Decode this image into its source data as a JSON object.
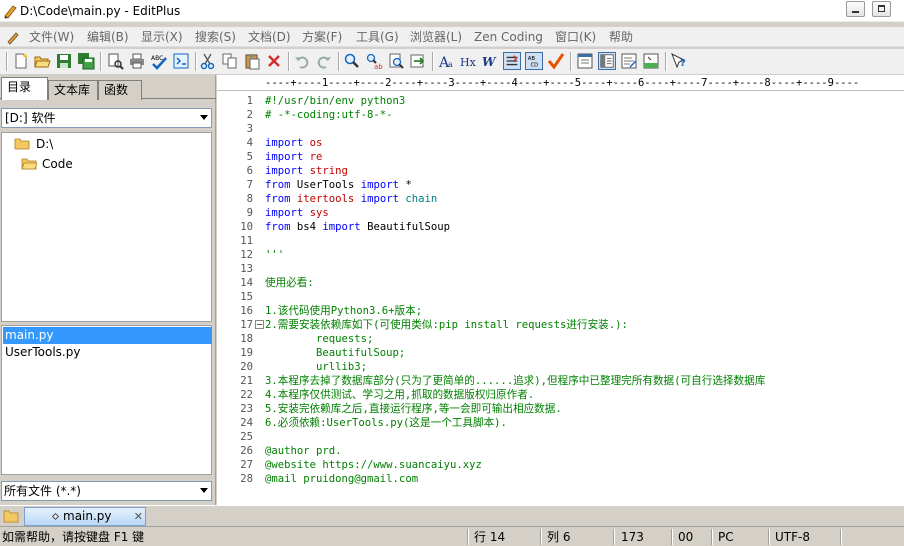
{
  "window": {
    "title": "D:\\Code\\main.py - EditPlus"
  },
  "menu": {
    "items": [
      "文件(W)",
      "编辑(B)",
      "显示(X)",
      "搜索(S)",
      "文档(D)",
      "方案(F)",
      "工具(G)",
      "浏览器(L)",
      "Zen Coding",
      "窗口(K)",
      "帮助"
    ]
  },
  "toolbar": {
    "icons": [
      "new-file-icon",
      "open-icon",
      "save-icon",
      "save-all-icon",
      "print-preview-icon",
      "print-icon",
      "spell-check-icon",
      "check-icon",
      "browser-view-icon",
      "cut-icon",
      "copy-icon",
      "paste-icon",
      "delete-icon",
      "undo-icon",
      "redo-icon",
      "find-icon",
      "replace-icon",
      "find-in-files-icon",
      "goto-icon",
      "font-icon",
      "hx-icon",
      "word-wrap-icon",
      "line-number-icon",
      "ruler-icon",
      "checkmark-icon",
      "fullscreen-icon",
      "directory-window-icon",
      "cliptext-icon",
      "output-window-icon",
      "help-icon"
    ]
  },
  "sidebar": {
    "tabs": [
      "目录",
      "文本库",
      "函数"
    ],
    "drive": "[D:] 软件",
    "tree": [
      "D:\\",
      "Code"
    ],
    "files": [
      "main.py",
      "UserTools.py"
    ],
    "filter": "所有文件 (*.*)"
  },
  "editor": {
    "ruler": "----+----1----+----2----+----3----+----4----+----5----+----6----+----7----+----8----+----9----",
    "lines": [
      {
        "n": "1",
        "segs": [
          [
            "c",
            "#!/usr/bin/env python3"
          ]
        ]
      },
      {
        "n": "2",
        "segs": [
          [
            "c",
            "# -*-coding:utf-8-*-"
          ]
        ]
      },
      {
        "n": "3",
        "segs": []
      },
      {
        "n": "4",
        "segs": [
          [
            "k",
            "import"
          ],
          [
            "t",
            " "
          ],
          [
            "m",
            "os"
          ]
        ]
      },
      {
        "n": "5",
        "segs": [
          [
            "k",
            "import"
          ],
          [
            "t",
            " "
          ],
          [
            "m",
            "re"
          ]
        ]
      },
      {
        "n": "6",
        "segs": [
          [
            "k",
            "import"
          ],
          [
            "t",
            " "
          ],
          [
            "m",
            "string"
          ]
        ]
      },
      {
        "n": "7",
        "segs": [
          [
            "k",
            "from"
          ],
          [
            "t",
            " UserTools "
          ],
          [
            "k",
            "import"
          ],
          [
            "t",
            " *"
          ]
        ]
      },
      {
        "n": "8",
        "segs": [
          [
            "k",
            "from"
          ],
          [
            "t",
            " "
          ],
          [
            "m",
            "itertools"
          ],
          [
            "t",
            " "
          ],
          [
            "k",
            "import"
          ],
          [
            "t",
            " "
          ],
          [
            "b",
            "chain"
          ]
        ]
      },
      {
        "n": "9",
        "segs": [
          [
            "k",
            "import"
          ],
          [
            "t",
            " "
          ],
          [
            "m",
            "sys"
          ]
        ]
      },
      {
        "n": "10",
        "segs": [
          [
            "k",
            "from"
          ],
          [
            "t",
            " bs4 "
          ],
          [
            "k",
            "import"
          ],
          [
            "t",
            " BeautifulSoup"
          ]
        ]
      },
      {
        "n": "11",
        "segs": []
      },
      {
        "n": "12",
        "segs": [
          [
            "c",
            "'''"
          ]
        ]
      },
      {
        "n": "13",
        "segs": []
      },
      {
        "n": "14",
        "segs": [
          [
            "c",
            "使用必看:"
          ]
        ]
      },
      {
        "n": "15",
        "segs": []
      },
      {
        "n": "16",
        "segs": [
          [
            "c",
            "1.该代码使用Python3.6+版本;"
          ]
        ]
      },
      {
        "n": "17",
        "segs": [
          [
            "c",
            "2.需要安装依赖库如下(可使用类似:pip install requests进行安装.):"
          ]
        ]
      },
      {
        "n": "18",
        "segs": [
          [
            "c",
            "        requests;"
          ]
        ]
      },
      {
        "n": "19",
        "segs": [
          [
            "c",
            "        BeautifulSoup;"
          ]
        ]
      },
      {
        "n": "20",
        "segs": [
          [
            "c",
            "        urllib3;"
          ]
        ]
      },
      {
        "n": "21",
        "segs": [
          [
            "c",
            "3.本程序去掉了数据库部分(只为了更简单的......追求),但程序中已整理完所有数据(可自行选择数据库"
          ]
        ]
      },
      {
        "n": "22",
        "segs": [
          [
            "c",
            "4.本程序仅供测试、学习之用,抓取的数据版权归原作者."
          ]
        ]
      },
      {
        "n": "23",
        "segs": [
          [
            "c",
            "5.安装完依赖库之后,直接运行程序,等一会即可输出相应数据."
          ]
        ]
      },
      {
        "n": "24",
        "segs": [
          [
            "c",
            "6.必须依赖:UserTools.py(这是一个工具脚本)."
          ]
        ]
      },
      {
        "n": "25",
        "segs": []
      },
      {
        "n": "26",
        "segs": [
          [
            "c",
            "@author prd."
          ]
        ]
      },
      {
        "n": "27",
        "segs": [
          [
            "c",
            "@website https://www.suancaiyu.xyz"
          ]
        ]
      },
      {
        "n": "28",
        "segs": [
          [
            "c",
            "@mail pruidong@gmail.com"
          ]
        ]
      }
    ]
  },
  "doctab": {
    "label": "main.py"
  },
  "status": {
    "help": "如需帮助，请按键盘 F1 键",
    "line": "行 14",
    "col": "列 6",
    "chars": "173",
    "unit": "00",
    "eol": "PC",
    "encoding": "UTF-8"
  },
  "colors": {
    "keyword": "#0000ff",
    "module": "#c00000",
    "comment": "#008000",
    "builtin": "#008080",
    "selection": "#3399ff"
  }
}
